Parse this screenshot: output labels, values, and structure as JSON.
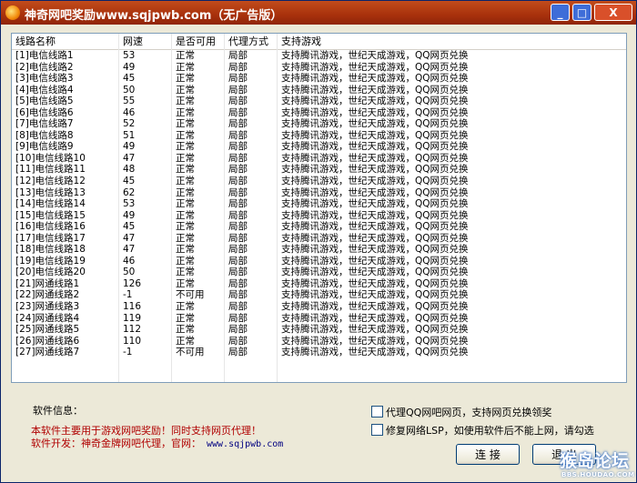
{
  "window": {
    "title": "神奇网吧奖励www.sqjpwb.com（无广告版）",
    "buttons": {
      "minimize": "_",
      "maximize": "□",
      "close": "X"
    }
  },
  "list": {
    "columns": [
      "线路名称",
      "网速",
      "是否可用",
      "代理方式",
      "支持游戏"
    ],
    "rows": [
      [
        "[1]电信线路1",
        "53",
        "正常",
        "局部",
        "支持腾讯游戏，世纪天成游戏，QQ网页兑换"
      ],
      [
        "[2]电信线路2",
        "49",
        "正常",
        "局部",
        "支持腾讯游戏，世纪天成游戏，QQ网页兑换"
      ],
      [
        "[3]电信线路3",
        "45",
        "正常",
        "局部",
        "支持腾讯游戏，世纪天成游戏，QQ网页兑换"
      ],
      [
        "[4]电信线路4",
        "50",
        "正常",
        "局部",
        "支持腾讯游戏，世纪天成游戏，QQ网页兑换"
      ],
      [
        "[5]电信线路5",
        "55",
        "正常",
        "局部",
        "支持腾讯游戏，世纪天成游戏，QQ网页兑换"
      ],
      [
        "[6]电信线路6",
        "46",
        "正常",
        "局部",
        "支持腾讯游戏，世纪天成游戏，QQ网页兑换"
      ],
      [
        "[7]电信线路7",
        "52",
        "正常",
        "局部",
        "支持腾讯游戏，世纪天成游戏，QQ网页兑换"
      ],
      [
        "[8]电信线路8",
        "51",
        "正常",
        "局部",
        "支持腾讯游戏，世纪天成游戏，QQ网页兑换"
      ],
      [
        "[9]电信线路9",
        "49",
        "正常",
        "局部",
        "支持腾讯游戏，世纪天成游戏，QQ网页兑换"
      ],
      [
        "[10]电信线路10",
        "47",
        "正常",
        "局部",
        "支持腾讯游戏，世纪天成游戏，QQ网页兑换"
      ],
      [
        "[11]电信线路11",
        "48",
        "正常",
        "局部",
        "支持腾讯游戏，世纪天成游戏，QQ网页兑换"
      ],
      [
        "[12]电信线路12",
        "45",
        "正常",
        "局部",
        "支持腾讯游戏，世纪天成游戏，QQ网页兑换"
      ],
      [
        "[13]电信线路13",
        "62",
        "正常",
        "局部",
        "支持腾讯游戏，世纪天成游戏，QQ网页兑换"
      ],
      [
        "[14]电信线路14",
        "53",
        "正常",
        "局部",
        "支持腾讯游戏，世纪天成游戏，QQ网页兑换"
      ],
      [
        "[15]电信线路15",
        "49",
        "正常",
        "局部",
        "支持腾讯游戏，世纪天成游戏，QQ网页兑换"
      ],
      [
        "[16]电信线路16",
        "45",
        "正常",
        "局部",
        "支持腾讯游戏，世纪天成游戏，QQ网页兑换"
      ],
      [
        "[17]电信线路17",
        "47",
        "正常",
        "局部",
        "支持腾讯游戏，世纪天成游戏，QQ网页兑换"
      ],
      [
        "[18]电信线路18",
        "47",
        "正常",
        "局部",
        "支持腾讯游戏，世纪天成游戏，QQ网页兑换"
      ],
      [
        "[19]电信线路19",
        "46",
        "正常",
        "局部",
        "支持腾讯游戏，世纪天成游戏，QQ网页兑换"
      ],
      [
        "[20]电信线路20",
        "50",
        "正常",
        "局部",
        "支持腾讯游戏，世纪天成游戏，QQ网页兑换"
      ],
      [
        "[21]网通线路1",
        "126",
        "正常",
        "局部",
        "支持腾讯游戏，世纪天成游戏，QQ网页兑换"
      ],
      [
        "[22]网通线路2",
        "-1",
        "不可用",
        "局部",
        "支持腾讯游戏，世纪天成游戏，QQ网页兑换"
      ],
      [
        "[23]网通线路3",
        "116",
        "正常",
        "局部",
        "支持腾讯游戏，世纪天成游戏，QQ网页兑换"
      ],
      [
        "[24]网通线路4",
        "119",
        "正常",
        "局部",
        "支持腾讯游戏，世纪天成游戏，QQ网页兑换"
      ],
      [
        "[25]网通线路5",
        "112",
        "正常",
        "局部",
        "支持腾讯游戏，世纪天成游戏，QQ网页兑换"
      ],
      [
        "[26]网通线路6",
        "110",
        "正常",
        "局部",
        "支持腾讯游戏，世纪天成游戏，QQ网页兑换"
      ],
      [
        "[27]网通线路7",
        "-1",
        "不可用",
        "局部",
        "支持腾讯游戏，世纪天成游戏，QQ网页兑换"
      ]
    ]
  },
  "info": {
    "group_label": "软件信息：",
    "line1": "本软件主要用于游戏网吧奖励！同时支持网页代理！",
    "line2": "软件开发：神奇金牌网吧代理，官网：",
    "site": "www.sqjpwb.com"
  },
  "options": {
    "proxy_qq_web": {
      "label": "代理QQ网吧网页，支持网页兑换领奖",
      "checked": false
    },
    "repair_lsp": {
      "label": "修复网络LSP，如使用软件后不能上网，请勾选",
      "checked": false
    }
  },
  "buttons": {
    "connect": "连 接",
    "exit": "退 出"
  },
  "watermark": {
    "main": "猴岛论坛",
    "sub": "BBS.HOUDAO.COM"
  }
}
